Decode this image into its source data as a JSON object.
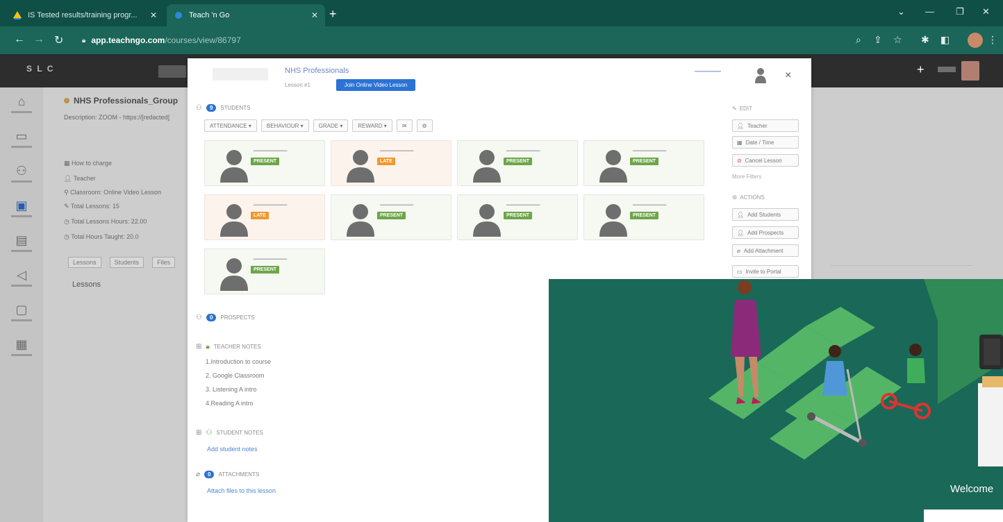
{
  "browser": {
    "tabs": [
      {
        "title": "IS Tested results/training progr...",
        "active": false
      },
      {
        "title": "Teach 'n Go",
        "active": true
      }
    ],
    "url_host": "app.teachngo.com",
    "url_path": "/courses/view/86797"
  },
  "app": {
    "brand": "S L C",
    "sidebar": [
      {
        "icon": "home-icon",
        "glyph": "⌂"
      },
      {
        "icon": "calendar-icon",
        "glyph": "▭"
      },
      {
        "icon": "users-icon",
        "glyph": "⚇"
      },
      {
        "icon": "courses-icon",
        "glyph": "▣"
      },
      {
        "icon": "billing-icon",
        "glyph": "▤"
      },
      {
        "icon": "marketing-icon",
        "glyph": "◁"
      },
      {
        "icon": "reports-icon",
        "glyph": "▢"
      },
      {
        "icon": "settings-icon",
        "glyph": "▦"
      }
    ]
  },
  "course": {
    "title": "NHS Professionals_Group",
    "description": "Description: ZOOM - https://[redacted]",
    "details": [
      "How to charge",
      "Teacher",
      "Classroom: Online Video Lesson",
      "Total Lessons: 15",
      "Total Lessons Hours: 22.00",
      "Total Hours Taught: 20.0"
    ],
    "tabs": [
      "Lessons",
      "Students",
      "Files"
    ],
    "lessons_heading": "Lessons"
  },
  "modal": {
    "title": "NHS Professionals",
    "subtitle": "Lesson #1",
    "live_btn": "Join Online Video Lesson",
    "close": "×",
    "students_count": "9",
    "students_label": "STUDENTS",
    "toolbar": [
      "ATTENDANCE ▾",
      "BEHAVIOUR ▾",
      "GRADE ▾",
      "REWARD ▾",
      "✉",
      "⚙"
    ],
    "students": [
      {
        "status": "PRESENT",
        "late": false
      },
      {
        "status": "LATE",
        "late": true
      },
      {
        "status": "PRESENT",
        "late": false
      },
      {
        "status": "PRESENT",
        "late": false
      },
      {
        "status": "LATE",
        "late": true
      },
      {
        "status": "PRESENT",
        "late": false
      },
      {
        "status": "PRESENT",
        "late": false
      },
      {
        "status": "PRESENT",
        "late": false
      },
      {
        "status": "PRESENT",
        "late": false
      }
    ],
    "prospects_count": "0",
    "prospects_label": "PROSPECTS",
    "teacher_notes_label": "TEACHER NOTES",
    "teacher_notes": [
      "1.Introduction to course",
      "2. Google Classroom",
      "3. Listening A intro",
      "4.Reading A intro"
    ],
    "student_notes_label": "STUDENT NOTES",
    "add_student_notes": "Add student notes",
    "attachments_count": "0",
    "attachments_label": "ATTACHMENTS",
    "attach_link": "Attach files to this lesson",
    "right_panel": {
      "edit_label": "EDIT",
      "btn_teacher": "Teacher",
      "btn_date": "Date / Time",
      "btn_cancel": "Cancel Lesson",
      "more_label": "More Filters",
      "actions_label": "ACTIONS",
      "btn_add_students": "Add Students",
      "btn_add_prospects": "Add Prospects",
      "btn_add_attachment": "Add Attachment",
      "btn_invite": "Invite to Portal"
    }
  },
  "video": {
    "welcome": "Welcome"
  },
  "colors": {
    "tabbar": "#0f4f46",
    "present": "#6ea54a",
    "late": "#f0982e",
    "accent": "#2b73d4"
  }
}
